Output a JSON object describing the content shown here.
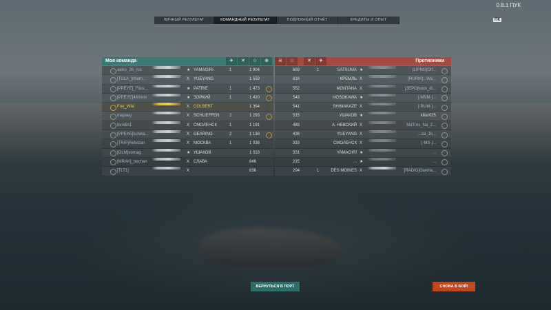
{
  "version": "0.8.1 ПУК",
  "version_tag": "ПК",
  "tabs": [
    "ЛИЧНЫЙ РЕЗУЛЬТАТ",
    "КОМАНДНЫЙ РЕЗУЛЬТАТ",
    "ПОДРОБНЫЙ ОТЧЁТ",
    "КРЕДИТЫ И ОПЫТ"
  ],
  "active_tab": 1,
  "my_team": {
    "title": "Моя команда",
    "header_icons": [
      "plane-icon",
      "frag-icon",
      "star-icon",
      "medal-icon"
    ],
    "rows": [
      {
        "player": "aleks_26_rus",
        "tier": "★",
        "ship": "YAMAGIRI",
        "kills": "1",
        "xp": "1 904",
        "medal": ""
      },
      {
        "player": "[TULA_]ribam...",
        "tier": "X",
        "ship": "YUEYANG",
        "kills": "",
        "xp": "1 559",
        "medal": ""
      },
      {
        "player": "[PPEYE]_Filos...",
        "tier": "★",
        "ship": "PATRIE",
        "kills": "1",
        "xp": "1 473",
        "medal": "gold"
      },
      {
        "player": "[PPEYE]460mm",
        "tier": "★",
        "ship": "ЗОРКИЙ",
        "kills": "1",
        "xp": "1 420",
        "medal": "gold"
      },
      {
        "player": "Frei_Wild",
        "tier": "X",
        "ship": "COLBERT",
        "kills": "",
        "xp": "1 364",
        "medal": ""
      },
      {
        "player": "mapsey",
        "tier": "X",
        "ship": "SCHLIEFFEN",
        "kills": "2",
        "xp": "1 293",
        "medal": "gold"
      },
      {
        "player": "fervitin1",
        "tier": "X",
        "ship": "СМОЛЕНСК",
        "kills": "1",
        "xp": "1 191",
        "medal": ""
      },
      {
        "player": "[PPEYE]sunwa...",
        "tier": "X",
        "ship": "GEARING",
        "kills": "2",
        "xp": "1 138",
        "medal": "gold"
      },
      {
        "player": "[TRIP]Retvizan",
        "tier": "X",
        "ship": "МОСКВА",
        "kills": "1",
        "xp": "1 038",
        "medal": ""
      },
      {
        "player": "[OLM]vornag",
        "tier": "★",
        "ship": "УШАКОВ",
        "kills": "",
        "xp": "1 018",
        "medal": ""
      },
      {
        "player": "[MRAK]_bechan",
        "tier": "X",
        "ship": "СЛАВА",
        "kills": "",
        "xp": "849",
        "medal": ""
      },
      {
        "player": "[TLT1]",
        "tier": "X",
        "ship": "",
        "kills": "",
        "xp": "838",
        "medal": ""
      }
    ]
  },
  "enemies": {
    "title": "Противники",
    "header_icons": [
      "skull-icon",
      "star-icon",
      "frag-icon",
      "plane-icon"
    ],
    "rows": [
      {
        "xp": "699",
        "kills": "1",
        "ship": "SATSUMA",
        "tier": "★",
        "player": "[LIPNG]Off..."
      },
      {
        "xp": "616",
        "kills": "",
        "ship": "КРЕМЛЬ",
        "tier": "X",
        "player": "[RURIK]...Wa..."
      },
      {
        "xp": "552",
        "kills": "",
        "ship": "MONTANA",
        "tier": "X",
        "player": "[ЗЕРО]tokin_di..."
      },
      {
        "xp": "543",
        "kills": "",
        "ship": "HOSOKAWA",
        "tier": "★",
        "player": "[-MSM-]..."
      },
      {
        "xp": "541",
        "kills": "",
        "ship": "SHIMAKAZE",
        "tier": "X",
        "player": "[-RUM-]..."
      },
      {
        "xp": "515",
        "kills": "",
        "ship": "УШАКОВ",
        "tier": "★",
        "player": "killer025"
      },
      {
        "xp": "488",
        "kills": "",
        "ship": "А. НЕВСКИЙ",
        "tier": "X",
        "player": "MaTros_Na_2..."
      },
      {
        "xp": "436",
        "kills": "",
        "ship": "YUEYANG",
        "tier": "X",
        "player": "...za_Jo..."
      },
      {
        "xp": "333",
        "kills": "",
        "ship": "СМОЛЕНСК",
        "tier": "X",
        "player": "[-MS-]..."
      },
      {
        "xp": "331",
        "kills": "",
        "ship": "YAMAGIRI",
        "tier": "★",
        "player": "..."
      },
      {
        "xp": "235",
        "kills": "",
        "ship": "...",
        "tier": "★",
        "player": "..."
      },
      {
        "xp": "204",
        "kills": "1",
        "ship": "DES MOINES",
        "tier": "X",
        "player": "[RADIO]Gavrila..."
      }
    ]
  },
  "buttons": {
    "port": "ВЕРНУТЬСЯ В ПОРТ",
    "battle": "СНОВА В БОЙ!"
  }
}
